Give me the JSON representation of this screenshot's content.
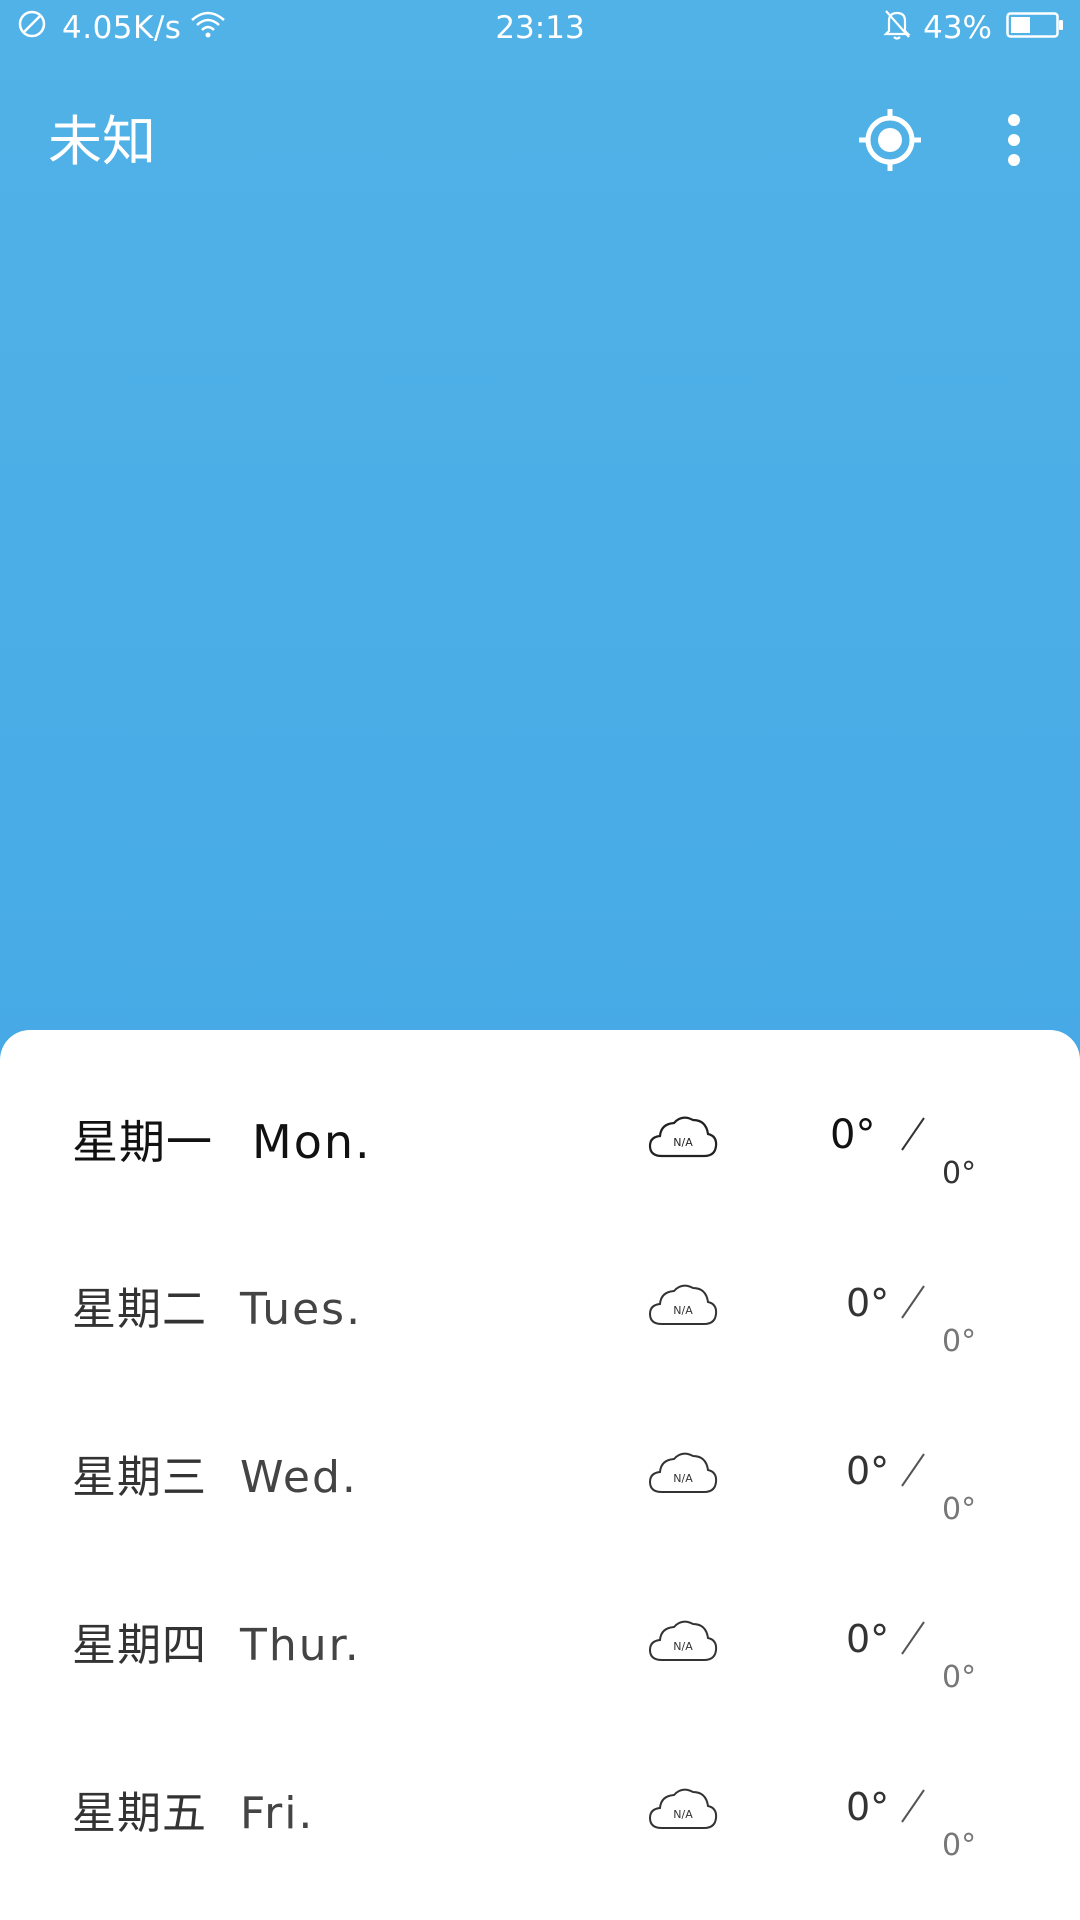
{
  "status_bar": {
    "network_speed": "4.05K/s",
    "time": "23:13",
    "battery_percent": "43%",
    "battery_level": 0.43,
    "icons": [
      "no-sim-icon",
      "wifi-icon",
      "bell-muted-icon",
      "battery-icon"
    ]
  },
  "app_bar": {
    "title": "未知",
    "locate_icon": "locate-icon",
    "more_icon": "more-vert-icon"
  },
  "forecast": [
    {
      "cn": "星期一",
      "en": "Mon.",
      "condition": "N/A",
      "high": "0°",
      "low": "0°",
      "active": true
    },
    {
      "cn": "星期二",
      "en": "Tues.",
      "condition": "N/A",
      "high": "0°",
      "low": "0°",
      "active": false
    },
    {
      "cn": "星期三",
      "en": "Wed.",
      "condition": "N/A",
      "high": "0°",
      "low": "0°",
      "active": false
    },
    {
      "cn": "星期四",
      "en": "Thur.",
      "condition": "N/A",
      "high": "0°",
      "low": "0°",
      "active": false
    },
    {
      "cn": "星期五",
      "en": "Fri.",
      "condition": "N/A",
      "high": "0°",
      "low": "0°",
      "active": false
    }
  ],
  "colors": {
    "sky_top": "#51b2e7",
    "sky_bottom": "#3ea4e5",
    "card_bg": "#ffffff",
    "text_primary": "#111111"
  }
}
